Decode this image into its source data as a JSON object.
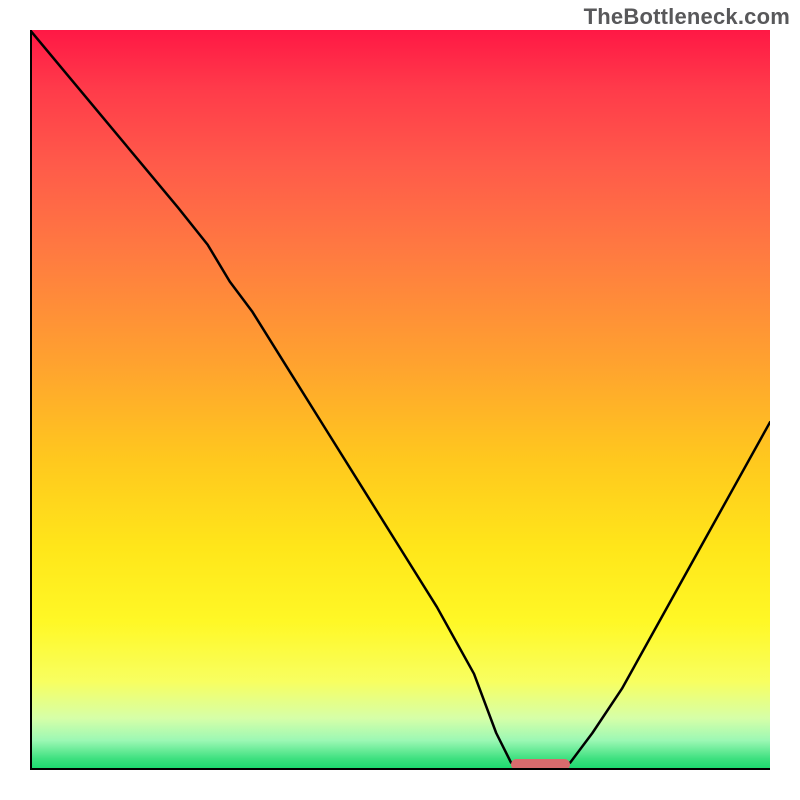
{
  "attribution": "TheBottleneck.com",
  "chart_data": {
    "type": "line",
    "title": "",
    "xlabel": "",
    "ylabel": "",
    "xlim": [
      0,
      100
    ],
    "ylim": [
      0,
      100
    ],
    "grid": false,
    "legend": false,
    "marker": {
      "x_start": 65,
      "x_end": 73,
      "y": 0.5,
      "color": "#d86b6d"
    },
    "curve": {
      "comment": "Estimated bottleneck% vs relative-power%. Minimum near 65-73%.",
      "x": [
        0,
        5,
        10,
        15,
        20,
        24,
        27,
        30,
        35,
        40,
        45,
        50,
        55,
        60,
        63,
        65,
        69,
        73,
        76,
        80,
        85,
        90,
        95,
        100
      ],
      "y": [
        100,
        94,
        88,
        82,
        76,
        71,
        66,
        62,
        54,
        46,
        38,
        30,
        22,
        13,
        5,
        1,
        0.5,
        1,
        5,
        11,
        20,
        29,
        38,
        47
      ]
    },
    "gradient_stops": [
      {
        "pct": 0,
        "color": "#ff1845"
      },
      {
        "pct": 8,
        "color": "#ff3b4a"
      },
      {
        "pct": 18,
        "color": "#ff5a4a"
      },
      {
        "pct": 30,
        "color": "#ff7a41"
      },
      {
        "pct": 45,
        "color": "#ffa22f"
      },
      {
        "pct": 58,
        "color": "#ffc81e"
      },
      {
        "pct": 70,
        "color": "#ffe61a"
      },
      {
        "pct": 80,
        "color": "#fff826"
      },
      {
        "pct": 88,
        "color": "#f8ff60"
      },
      {
        "pct": 93,
        "color": "#d6ffa8"
      },
      {
        "pct": 96,
        "color": "#9cf8b4"
      },
      {
        "pct": 98.5,
        "color": "#3de07f"
      },
      {
        "pct": 100,
        "color": "#17d86c"
      }
    ]
  }
}
